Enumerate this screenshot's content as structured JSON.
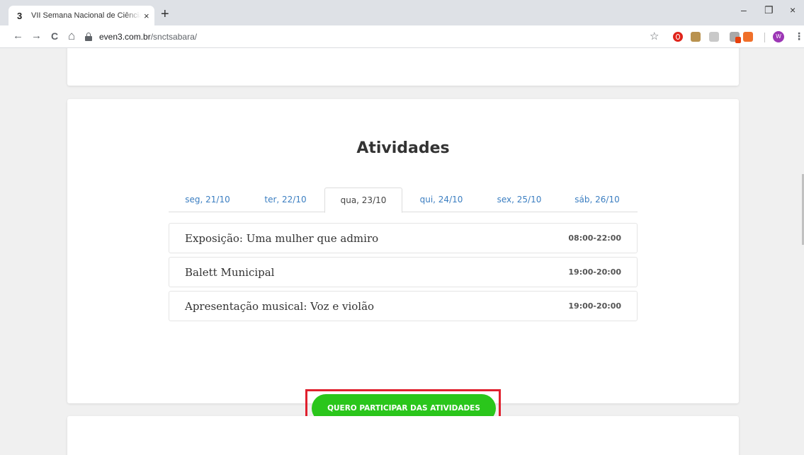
{
  "browser": {
    "tab_favicon": "3",
    "tab_title": "VII Semana Nacional de Ciência e Tecnologia",
    "tab_close": "×",
    "new_tab": "+",
    "window_controls": {
      "minimize": "–",
      "restore": "❐",
      "close": "×"
    },
    "nav": {
      "back": "←",
      "forward": "→",
      "reload": "C",
      "home": "⌂"
    },
    "url_domain": "even3.com.br",
    "url_path": "/snctsabara/",
    "bookmark_star": "☆",
    "extensions": [
      "opera-icon",
      "face-extension-icon",
      "m-extension-icon",
      "chat-extension-icon",
      "q-extension-icon"
    ],
    "profile_initial": "W",
    "menu": "⋮"
  },
  "activities": {
    "title": "Atividades",
    "tabs": [
      {
        "label": "seg, 21/10"
      },
      {
        "label": "ter, 22/10"
      },
      {
        "label": "qua, 23/10",
        "active": true
      },
      {
        "label": "qui, 24/10"
      },
      {
        "label": "sex, 25/10"
      },
      {
        "label": "sáb, 26/10"
      }
    ],
    "items": [
      {
        "name": "Exposição: Uma mulher que admiro",
        "time": "08:00-22:00"
      },
      {
        "name": "Balett Municipal",
        "time": "19:00-20:00"
      },
      {
        "name": "Apresentação musical: Voz e violão",
        "time": "19:00-20:00"
      }
    ],
    "cta_label": "QUERO PARTICIPAR DAS ATIVIDADES"
  },
  "colors": {
    "link": "#3b7ec1",
    "cta_green": "#2ac61b",
    "highlight_red": "#e0202e"
  }
}
